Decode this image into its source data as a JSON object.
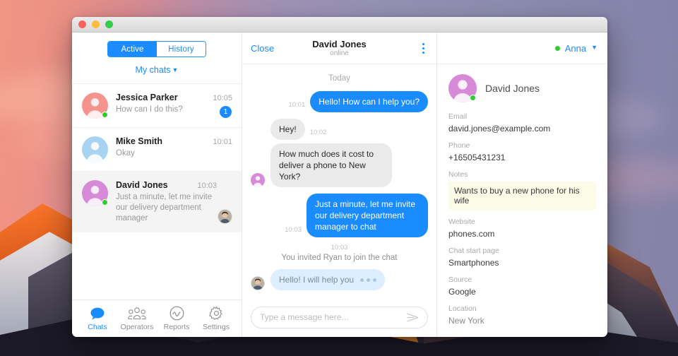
{
  "window": {
    "traffic_lights": [
      "close",
      "minimize",
      "zoom"
    ]
  },
  "sidebar": {
    "segmented": {
      "active_label": "Active",
      "history_label": "History",
      "selected": "Active"
    },
    "my_chats_label": "My chats",
    "chats": [
      {
        "name": "Jessica Parker",
        "preview": "How can I do this?",
        "time": "10:05",
        "badge": "1",
        "avatar_color": "#f4948d",
        "online": true,
        "has_photo": false
      },
      {
        "name": "Mike Smith",
        "preview": "Okay",
        "time": "10:01",
        "badge": "",
        "avatar_color": "#a8d3f2",
        "online": false,
        "has_photo": false
      },
      {
        "name": "David Jones",
        "preview": "Just a minute, let me invite our delivery department manager",
        "time": "10:03",
        "badge": "",
        "avatar_color": "#d78ad8",
        "online": true,
        "has_photo": true
      }
    ],
    "nav": [
      {
        "label": "Chats",
        "icon": "chat-bubble-icon",
        "active": true
      },
      {
        "label": "Operators",
        "icon": "operators-icon",
        "active": false
      },
      {
        "label": "Reports",
        "icon": "reports-chart-icon",
        "active": false
      },
      {
        "label": "Settings",
        "icon": "gear-icon",
        "active": false
      }
    ]
  },
  "chat": {
    "close_label": "Close",
    "title": "David Jones",
    "status": "online",
    "menu_icon": "kebab-menu-icon",
    "day_separator": "Today",
    "messages": [
      {
        "side": "out",
        "time": "10:01",
        "text": "Hello! How can I help you?"
      },
      {
        "side": "in",
        "time": "10:02",
        "text": "Hey!"
      },
      {
        "side": "in",
        "time": "",
        "text": "How much does it cost to deliver a phone to New York?"
      },
      {
        "side": "out",
        "time": "10:03",
        "text": "Just a minute, let me invite our delivery department manager to chat"
      }
    ],
    "system": {
      "time": "10:03",
      "text": "You invited Ryan to join the chat"
    },
    "agent_message": {
      "text": "Hello! I will help you",
      "typing": true
    },
    "composer": {
      "placeholder": "Type a message here...",
      "value": "",
      "send_icon": "send-arrow-icon"
    }
  },
  "right_panel": {
    "operator": {
      "name": "Anna",
      "status_color": "#2fcc2f"
    },
    "contact": {
      "name": "David Jones",
      "avatar_color": "#d78ad8",
      "online": true
    },
    "fields": [
      {
        "key": "Email",
        "value": "david.jones@example.com",
        "style": "normal"
      },
      {
        "key": "Phone",
        "value": "+16505431231",
        "style": "normal"
      },
      {
        "key": "Notes",
        "value": "Wants to buy a new phone for his wife",
        "style": "note"
      },
      {
        "key": "Website",
        "value": "phones.com",
        "style": "normal"
      },
      {
        "key": "Chat start page",
        "value": "Smartphones",
        "style": "normal"
      },
      {
        "key": "Source",
        "value": "Google",
        "style": "normal"
      },
      {
        "key": "Location",
        "value": "New York",
        "style": "dim"
      }
    ]
  },
  "colors": {
    "accent": "#1a8cff",
    "online": "#2fcc2f",
    "bubble_in": "#eaeaea",
    "bubble_agent": "#dceeff",
    "note_bg": "#fbfbe8"
  }
}
